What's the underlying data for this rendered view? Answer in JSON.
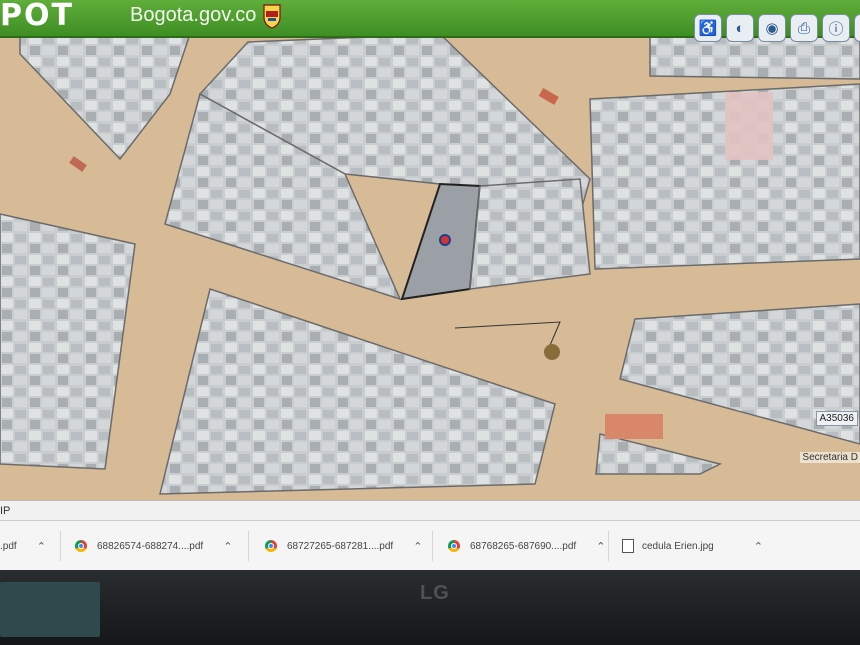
{
  "header": {
    "app_title": "POT",
    "site_name": "Bogota.gov.co"
  },
  "tools": [
    {
      "icon": "accessibility-icon",
      "glyph": "♿"
    },
    {
      "icon": "globe-icon",
      "glyph": "◐"
    },
    {
      "icon": "pin-icon",
      "glyph": "◉"
    },
    {
      "icon": "print-icon",
      "glyph": "⎙"
    },
    {
      "icon": "info-icon",
      "glyph": "ⓘ"
    },
    {
      "icon": "expand-icon",
      "glyph": "⤢"
    }
  ],
  "map": {
    "scale_label": "A35036",
    "attribution": "Secretaria D"
  },
  "status": {
    "text": "IP"
  },
  "downloads": [
    {
      "name": ".pdf",
      "type": "pdf"
    },
    {
      "name": "68826574-688274....pdf",
      "type": "pdf"
    },
    {
      "name": "68727265-687281....pdf",
      "type": "pdf"
    },
    {
      "name": "68768265-687690....pdf",
      "type": "pdf"
    },
    {
      "name": "cedula Erien.jpg",
      "type": "jpg"
    }
  ],
  "monitor": {
    "brand": "LG"
  }
}
